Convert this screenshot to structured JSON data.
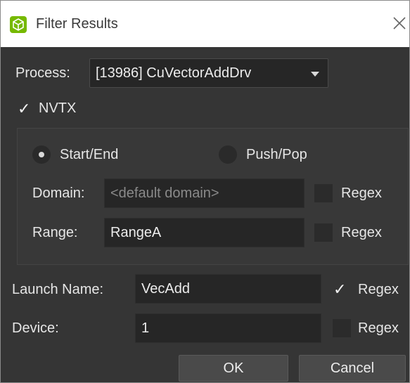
{
  "window": {
    "title": "Filter Results"
  },
  "process": {
    "label": "Process:",
    "selected": "[13986] CuVectorAddDrv"
  },
  "nvtx": {
    "label": "NVTX",
    "checked": true,
    "mode_start_end": "Start/End",
    "mode_push_pop": "Push/Pop",
    "domain": {
      "label": "Domain:",
      "value": "",
      "placeholder": "<default domain>",
      "regex_label": "Regex",
      "regex_checked": false
    },
    "range": {
      "label": "Range:",
      "value": "RangeA",
      "placeholder": "",
      "regex_label": "Regex",
      "regex_checked": false
    }
  },
  "launch_name": {
    "label": "Launch Name:",
    "value": "VecAdd",
    "regex_label": "Regex",
    "regex_checked": true
  },
  "device": {
    "label": "Device:",
    "value": "1",
    "regex_label": "Regex",
    "regex_checked": false
  },
  "buttons": {
    "ok": "OK",
    "cancel": "Cancel"
  },
  "icons": {
    "app": "cube-icon",
    "close": "close-icon",
    "dropdown": "chevron-down-icon",
    "check": "checkmark-icon"
  }
}
